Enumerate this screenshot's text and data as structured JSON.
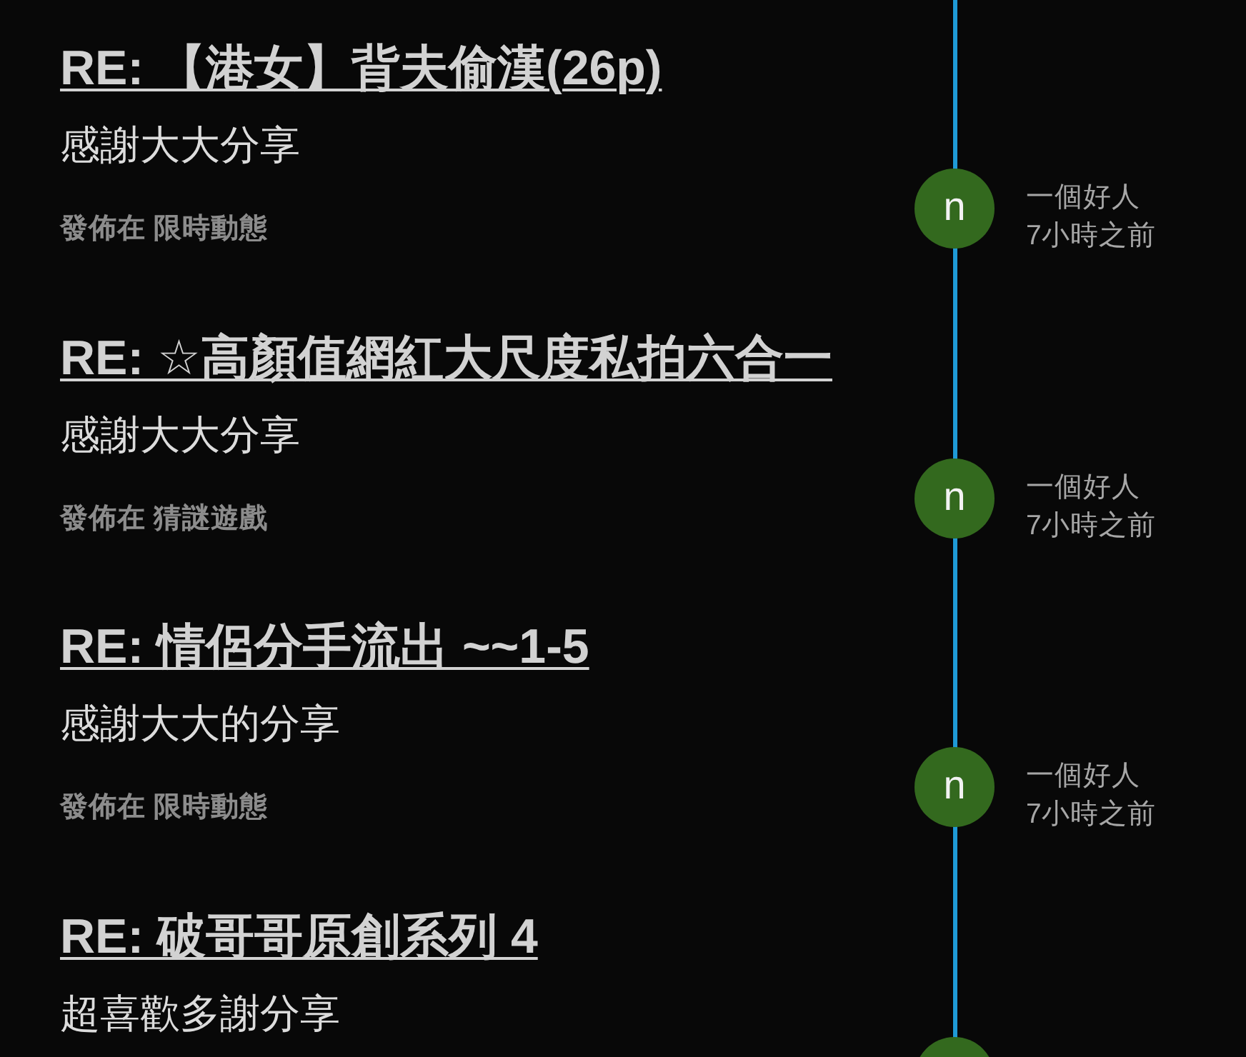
{
  "replies": [
    {
      "title": "RE: 【港女】背夫偷漢(26p)",
      "excerpt": "感謝大大分享",
      "posted_in": "發佈在 限時動態",
      "avatar_letter": "n",
      "author": "一個好人",
      "time": "7小時之前"
    },
    {
      "title": "RE: ☆高顏值網紅大尺度私拍六合一",
      "excerpt": "感謝大大分享",
      "posted_in": "發佈在 猜謎遊戲",
      "avatar_letter": "n",
      "author": "一個好人",
      "time": "7小時之前"
    },
    {
      "title": "RE: 情侶分手流出 ~~1-5",
      "excerpt": "感謝大大的分享",
      "posted_in": "發佈在 限時動態",
      "avatar_letter": "n",
      "author": "一個好人",
      "time": "7小時之前"
    },
    {
      "title": "RE: 破哥哥原創系列 4",
      "excerpt": "超喜歡多謝分享"
    }
  ]
}
